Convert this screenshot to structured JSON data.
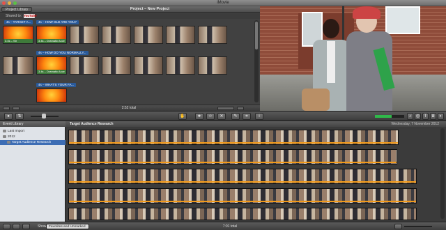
{
  "app": {
    "title": "iMovie"
  },
  "project_library": {
    "button_label": "Project Library",
    "project_title": "Project – New Project",
    "shared_to_label": "Shared to:",
    "shared_service": "YouTube",
    "total": "2:52 total",
    "rows": [
      {
        "theme_tag": "4s – TARGET A...",
        "theme_tag_2": "4s – HOW OLD ARE YOU?",
        "clip1_bar": "3.4s – Str",
        "clip2_bar": "3.4s – Dramatic Acce"
      },
      {
        "theme_tag": "4s – HOW DO YOU NORMALLY...",
        "clip2_bar": "3.4s – Dramatic Acce"
      },
      {
        "theme_tag": "4s – WHAT'S YOUR FA..."
      }
    ]
  },
  "event_library": {
    "title": "Event Library",
    "items": [
      {
        "label": "Last Import"
      },
      {
        "label": "2012"
      },
      {
        "label": "Target Audience Research"
      }
    ]
  },
  "event_browser": {
    "title": "Target Audience Research",
    "date": "Wednesday, 7 November 2012"
  },
  "bottom_bar": {
    "show_label": "Show:",
    "show_value": "Favorites and Unmarked",
    "total": "7:01 total"
  },
  "colors": {
    "selection": "#3d6db4",
    "theme_tag": "#2a5a9a",
    "clip_bar": "#3e7a3a",
    "audio_meter": "#2fb84a",
    "favorite_line": "#f29a1a"
  }
}
